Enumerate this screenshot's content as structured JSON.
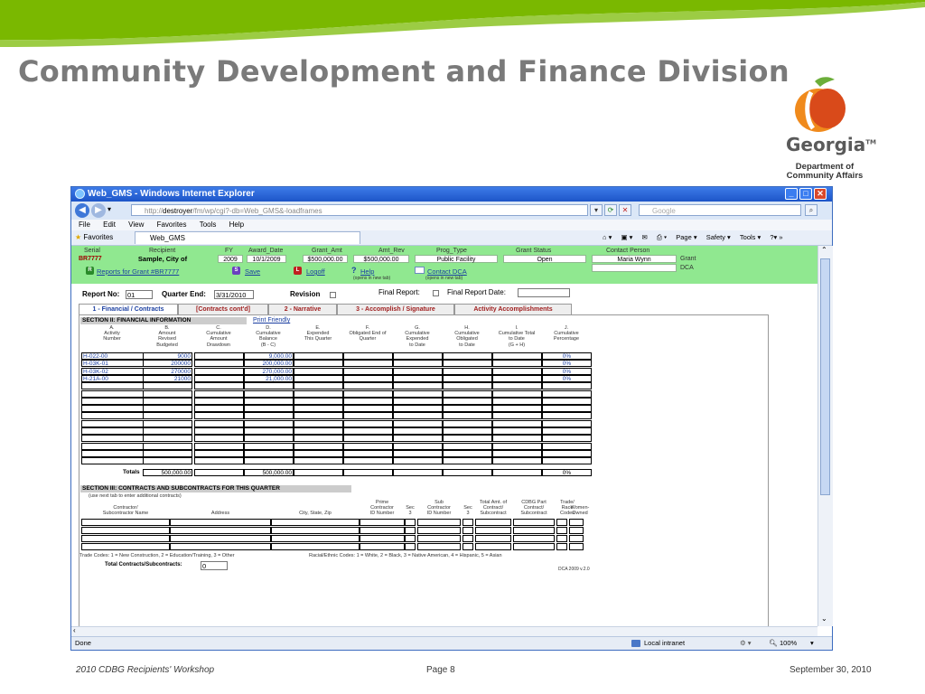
{
  "slide": {
    "title": "Community Development and Finance Division",
    "logo_name": "Georgia",
    "logo_dept_line1": "Department of",
    "logo_dept_line2": "Community Affairs",
    "footer_left": "2010 CDBG Recipients' Workshop",
    "footer_center": "Page 8",
    "footer_right": "September 30, 2010"
  },
  "browser": {
    "title": "Web_GMS - Windows Internet Explorer",
    "url_host": "http://",
    "url_bold": "destroyer",
    "url_rest": "/fm/wp/cgi?-db=Web_GMS&-loadframes",
    "search_placeholder": "Google",
    "menu": [
      "File",
      "Edit",
      "View",
      "Favorites",
      "Tools",
      "Help"
    ],
    "favorites_label": "Favorites",
    "tab_label": "Web_GMS",
    "toolbar_items": [
      "Page ▾",
      "Safety ▾",
      "Tools ▾"
    ],
    "status_left": "Done",
    "status_zone": "Local intranet",
    "status_zoom": "100%"
  },
  "header": {
    "labels": {
      "serial": "Serial",
      "recipient": "Recipient",
      "fy": "FY",
      "award_date": "Award_Date",
      "grant_amt": "Grant_Amt",
      "amt_rev": "Amt_Rev",
      "prog_type": "Prog_Type",
      "grant_status": "Grant Status",
      "contact_person": "Contact Person"
    },
    "values": {
      "serial": "BR7777",
      "recipient": "Sample, City of",
      "fy": "2009",
      "award_date": "10/1/2009",
      "grant_amt": "$500,000.00",
      "amt_rev": "$500,000.00",
      "prog_type": "Public Facility",
      "grant_status": "Open",
      "contact_person": "Maria Wynn"
    },
    "contact_grant": "Grant",
    "contact_dca": "DCA",
    "reports_link": "Reports for Grant #BR7777",
    "save_link": "Save",
    "logoff_link": "Logoff",
    "help_link": "Help",
    "help_note": "(opens in new tab)",
    "contact_link": "Contact DCA",
    "contact_note": "(opens in new tab)"
  },
  "report": {
    "report_no_label": "Report No:",
    "report_no_value": "01",
    "quarter_end_label": "Quarter End:",
    "quarter_end_value": "3/31/2010",
    "revision_label": "Revision",
    "final_report_label": "Final Report:",
    "final_report_date_label": "Final Report Date:",
    "final_report_date_value": ""
  },
  "tabs": [
    "1 - Financial / Contracts",
    "[Contracts cont'd]",
    "2 - Narrative",
    "3 - Accomplish / Signature",
    "Activity Accomplishments"
  ],
  "section2": {
    "title": "SECTION II: FINANCIAL INFORMATION",
    "print_link": "Print Friendly",
    "columns": [
      [
        "A.",
        "Activity",
        "Number"
      ],
      [
        "B.",
        "Amount",
        "Revised",
        "Budgeted"
      ],
      [
        "C.",
        "Cumulative",
        "Amount",
        "Drawdown"
      ],
      [
        "D.",
        "Cumulative",
        "Balance",
        "(B - C)"
      ],
      [
        "E.",
        "Expended",
        "This Quarter"
      ],
      [
        "F.",
        "Obligated End of",
        "Quarter"
      ],
      [
        "G.",
        "Cumulative",
        "Expended",
        "to Date"
      ],
      [
        "H.",
        "Cumulative",
        "Obligated",
        "to Date"
      ],
      [
        "I.",
        "Cumulative Total",
        "to Date",
        "(G + H)"
      ],
      [
        "J.",
        "Cumulative",
        "Percentage"
      ]
    ],
    "rows": [
      [
        "H-022-00",
        "9000",
        "",
        "9,000.00",
        "",
        "",
        "",
        "",
        "",
        "0%"
      ],
      [
        "H-03K-01",
        "200000",
        "",
        "200,000.00",
        "",
        "",
        "",
        "",
        "",
        "0%"
      ],
      [
        "H-03K-02",
        "270000",
        "",
        "270,000.00",
        "",
        "",
        "",
        "",
        "",
        "0%"
      ],
      [
        "H-21A-00",
        "21000",
        "",
        "21,000.00",
        "",
        "",
        "",
        "",
        "",
        "0%"
      ]
    ],
    "empty_rows": 11,
    "totals_label": "Totals",
    "totals": [
      "500,000.00",
      "",
      "500,000.00",
      "",
      "",
      "",
      "",
      "",
      "0%"
    ]
  },
  "section3": {
    "title": "SECTION III: CONTRACTS AND SUBCONTRACTS FOR THIS QUARTER",
    "note": "(use next tab to enter additional contracts)",
    "headers": {
      "contractor": [
        "Contractor/",
        "Subcontractor Name"
      ],
      "address": [
        "Address"
      ],
      "city": [
        "City, State, Zip"
      ],
      "prime": [
        "Prime",
        "Contractor",
        "ID Number"
      ],
      "sec3a": [
        "Sec",
        "3"
      ],
      "sub": [
        "Sub",
        "Contractor",
        "ID Number"
      ],
      "sec3b": [
        "Sec",
        "3"
      ],
      "total_amt": [
        "Total Amt. of",
        "Contract/",
        "Subcontract"
      ],
      "cdbg_part": [
        "CDBG Part",
        "Contract/",
        "Subcontract"
      ],
      "trade": [
        "Trade/",
        "Race",
        "Codes"
      ],
      "women": [
        "Women-",
        "Owned"
      ]
    },
    "trade_codes": "Trade Codes: 1 = New Construction, 2 = Education/Training, 3 = Other",
    "race_codes": "Racial/Ethnic Codes: 1 = White, 2 = Black, 3 = Native American, 4 = Hispanic, 5 = Asian",
    "total_label": "Total Contracts/Subcontracts:",
    "total_value": "0",
    "version": "DCA 2009 v.2.0"
  }
}
